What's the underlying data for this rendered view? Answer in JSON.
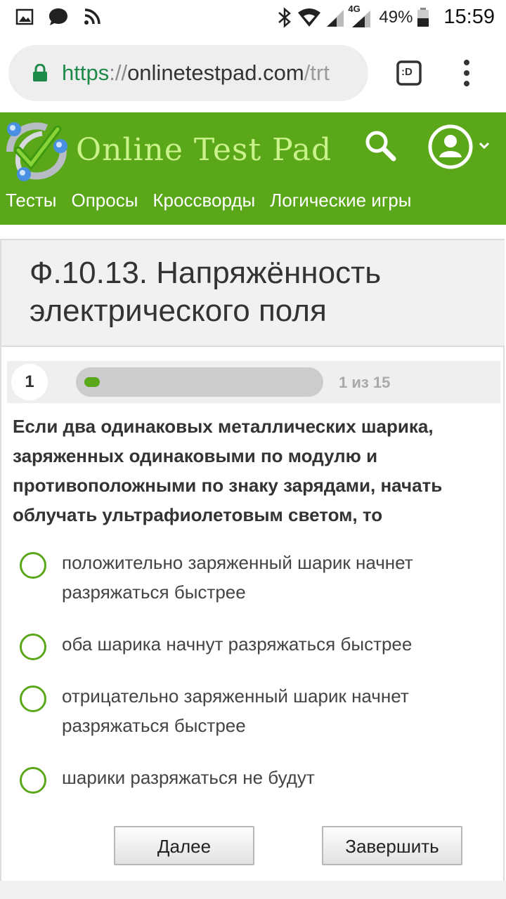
{
  "status_bar": {
    "battery_percent": "49%",
    "time": "15:59",
    "network_label": "4G",
    "icons": [
      "gallery-icon",
      "chat-icon",
      "rss-icon",
      "bluetooth-icon",
      "wifi-icon",
      "signal-icon",
      "signal-4g-icon",
      "battery-icon"
    ]
  },
  "browser": {
    "url_scheme": "https",
    "url_separator": "://",
    "url_host": "onlinetestpad.com",
    "url_path": "/trt",
    "tabs_label": ":D"
  },
  "site": {
    "title": "Online Test Pad",
    "nav": [
      "Тесты",
      "Опросы",
      "Кроссворды",
      "Логические игры"
    ],
    "colors": {
      "header_green": "#5aa719",
      "title_green": "#c9f28a",
      "radio_green": "#5aa719"
    }
  },
  "test": {
    "title": "Ф.10.13. Напряжённость электрического поля",
    "question_number": "1",
    "progress_text": "1 из 15",
    "progress_fraction": 0.067,
    "question": "Если два одинаковых металлических шарика, заряженных одинаковыми по модулю и противоположными по знаку зарядами, начать облучать ультрафиолетовым светом, то",
    "answers": [
      "положительно заряженный шарик начнет разряжаться быстрее",
      "оба шарика начнут разряжаться быстрее",
      "отрицательно заряженный шарик начнет разряжаться быстрее",
      "шарики разряжаться не будут"
    ],
    "next_label": "Далее",
    "finish_label": "Завершить"
  }
}
